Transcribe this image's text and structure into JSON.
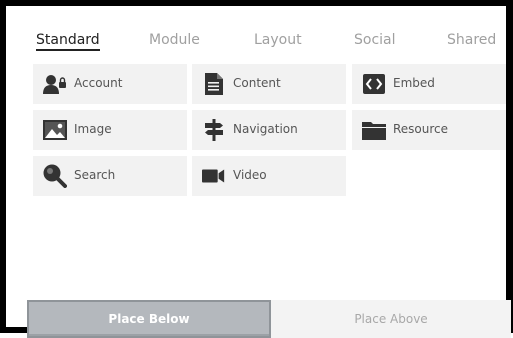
{
  "tabs": [
    {
      "label": "Standard",
      "active": true
    },
    {
      "label": "Module",
      "active": false
    },
    {
      "label": "Layout",
      "active": false
    },
    {
      "label": "Social",
      "active": false
    },
    {
      "label": "Shared",
      "active": false
    }
  ],
  "tiles": [
    {
      "label": "Account",
      "icon": "account-lock-icon"
    },
    {
      "label": "Content",
      "icon": "document-icon"
    },
    {
      "label": "Embed",
      "icon": "code-icon"
    },
    {
      "label": "Image",
      "icon": "image-icon"
    },
    {
      "label": "Navigation",
      "icon": "signpost-icon"
    },
    {
      "label": "Resource",
      "icon": "folder-icon"
    },
    {
      "label": "Search",
      "icon": "search-icon"
    },
    {
      "label": "Video",
      "icon": "video-camera-icon"
    }
  ],
  "footer": {
    "place_below_label": "Place Below",
    "place_above_label": "Place Above"
  },
  "colors": {
    "icon": "#333333",
    "tile_bg": "#f2f2f2",
    "active_button": "#b4b8bd"
  }
}
